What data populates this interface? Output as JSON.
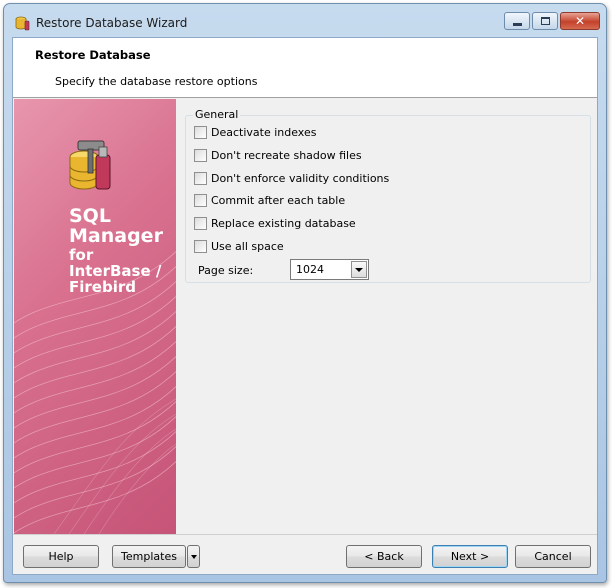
{
  "window": {
    "title": "Restore Database Wizard",
    "app_icon": "database-wizard-icon"
  },
  "header": {
    "title": "Restore Database",
    "subtitle": "Specify the database restore options"
  },
  "branding": {
    "line1": "SQL",
    "line2": "Manager",
    "line3": "for",
    "line4": "InterBase /",
    "line5": "Firebird",
    "colors": {
      "panel_top": "#e896ae",
      "panel_bottom": "#c65478"
    }
  },
  "general": {
    "label": "General",
    "options": [
      {
        "label": "Deactivate indexes",
        "checked": false
      },
      {
        "label": "Don't recreate shadow files",
        "checked": false
      },
      {
        "label": "Don't enforce validity conditions",
        "checked": false
      },
      {
        "label": "Commit after each table",
        "checked": false
      },
      {
        "label": "Replace existing database",
        "checked": false
      },
      {
        "label": "Use all space",
        "checked": false
      }
    ],
    "page_size": {
      "label": "Page size:",
      "value": "1024"
    }
  },
  "buttons": {
    "help": "Help",
    "templates": "Templates",
    "back": "< Back",
    "next": "Next >",
    "cancel": "Cancel"
  }
}
